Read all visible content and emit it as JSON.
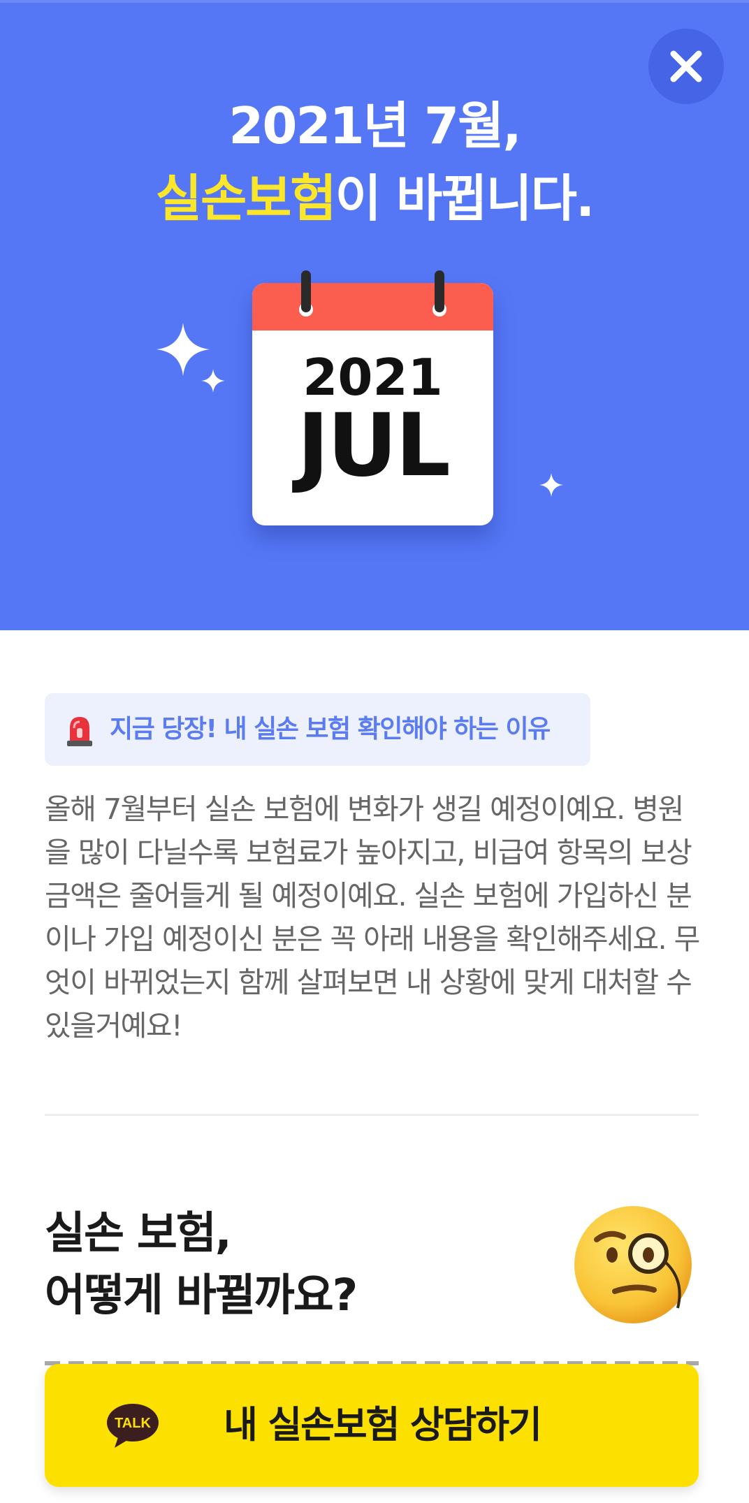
{
  "hero": {
    "title_line1": "2021년 7월,",
    "title_highlight": "실손보험",
    "title_line2_rest": "이 바뀝니다.",
    "calendar_year": "2021",
    "calendar_month": "JUL",
    "background_color": "#5577f6",
    "highlight_color": "#fbe62a"
  },
  "close_button": {
    "icon": "close-icon"
  },
  "banner": {
    "icon": "siren-icon",
    "text": "지금 당장! 내 실손 보험 확인해야 하는 이유",
    "text_color": "#5a7cf0"
  },
  "description": "올해 7월부터 실손 보험에 변화가 생길 예정이예요. 병원을 많이 다닐수록 보험료가 높아지고, 비급여 항목의 보상 금액은 줄어들게 될 예정이예요. 실손 보험에 가입하신 분이나 가입 예정이신 분은 꼭 아래 내용을 확인해주세요. 무엇이 바뀌었는지 함께 살펴보면 내 상황에 맞게 대처할 수 있을거예요!",
  "section": {
    "title_line1": "실손 보험,",
    "title_line2": "어떻게 바뀔까요?",
    "emoji": "face-with-monocle-icon"
  },
  "cta": {
    "icon": "kakaotalk-icon",
    "icon_text": "TALK",
    "label": "내 실손보험 상담하기",
    "background_color": "#fbe000"
  }
}
